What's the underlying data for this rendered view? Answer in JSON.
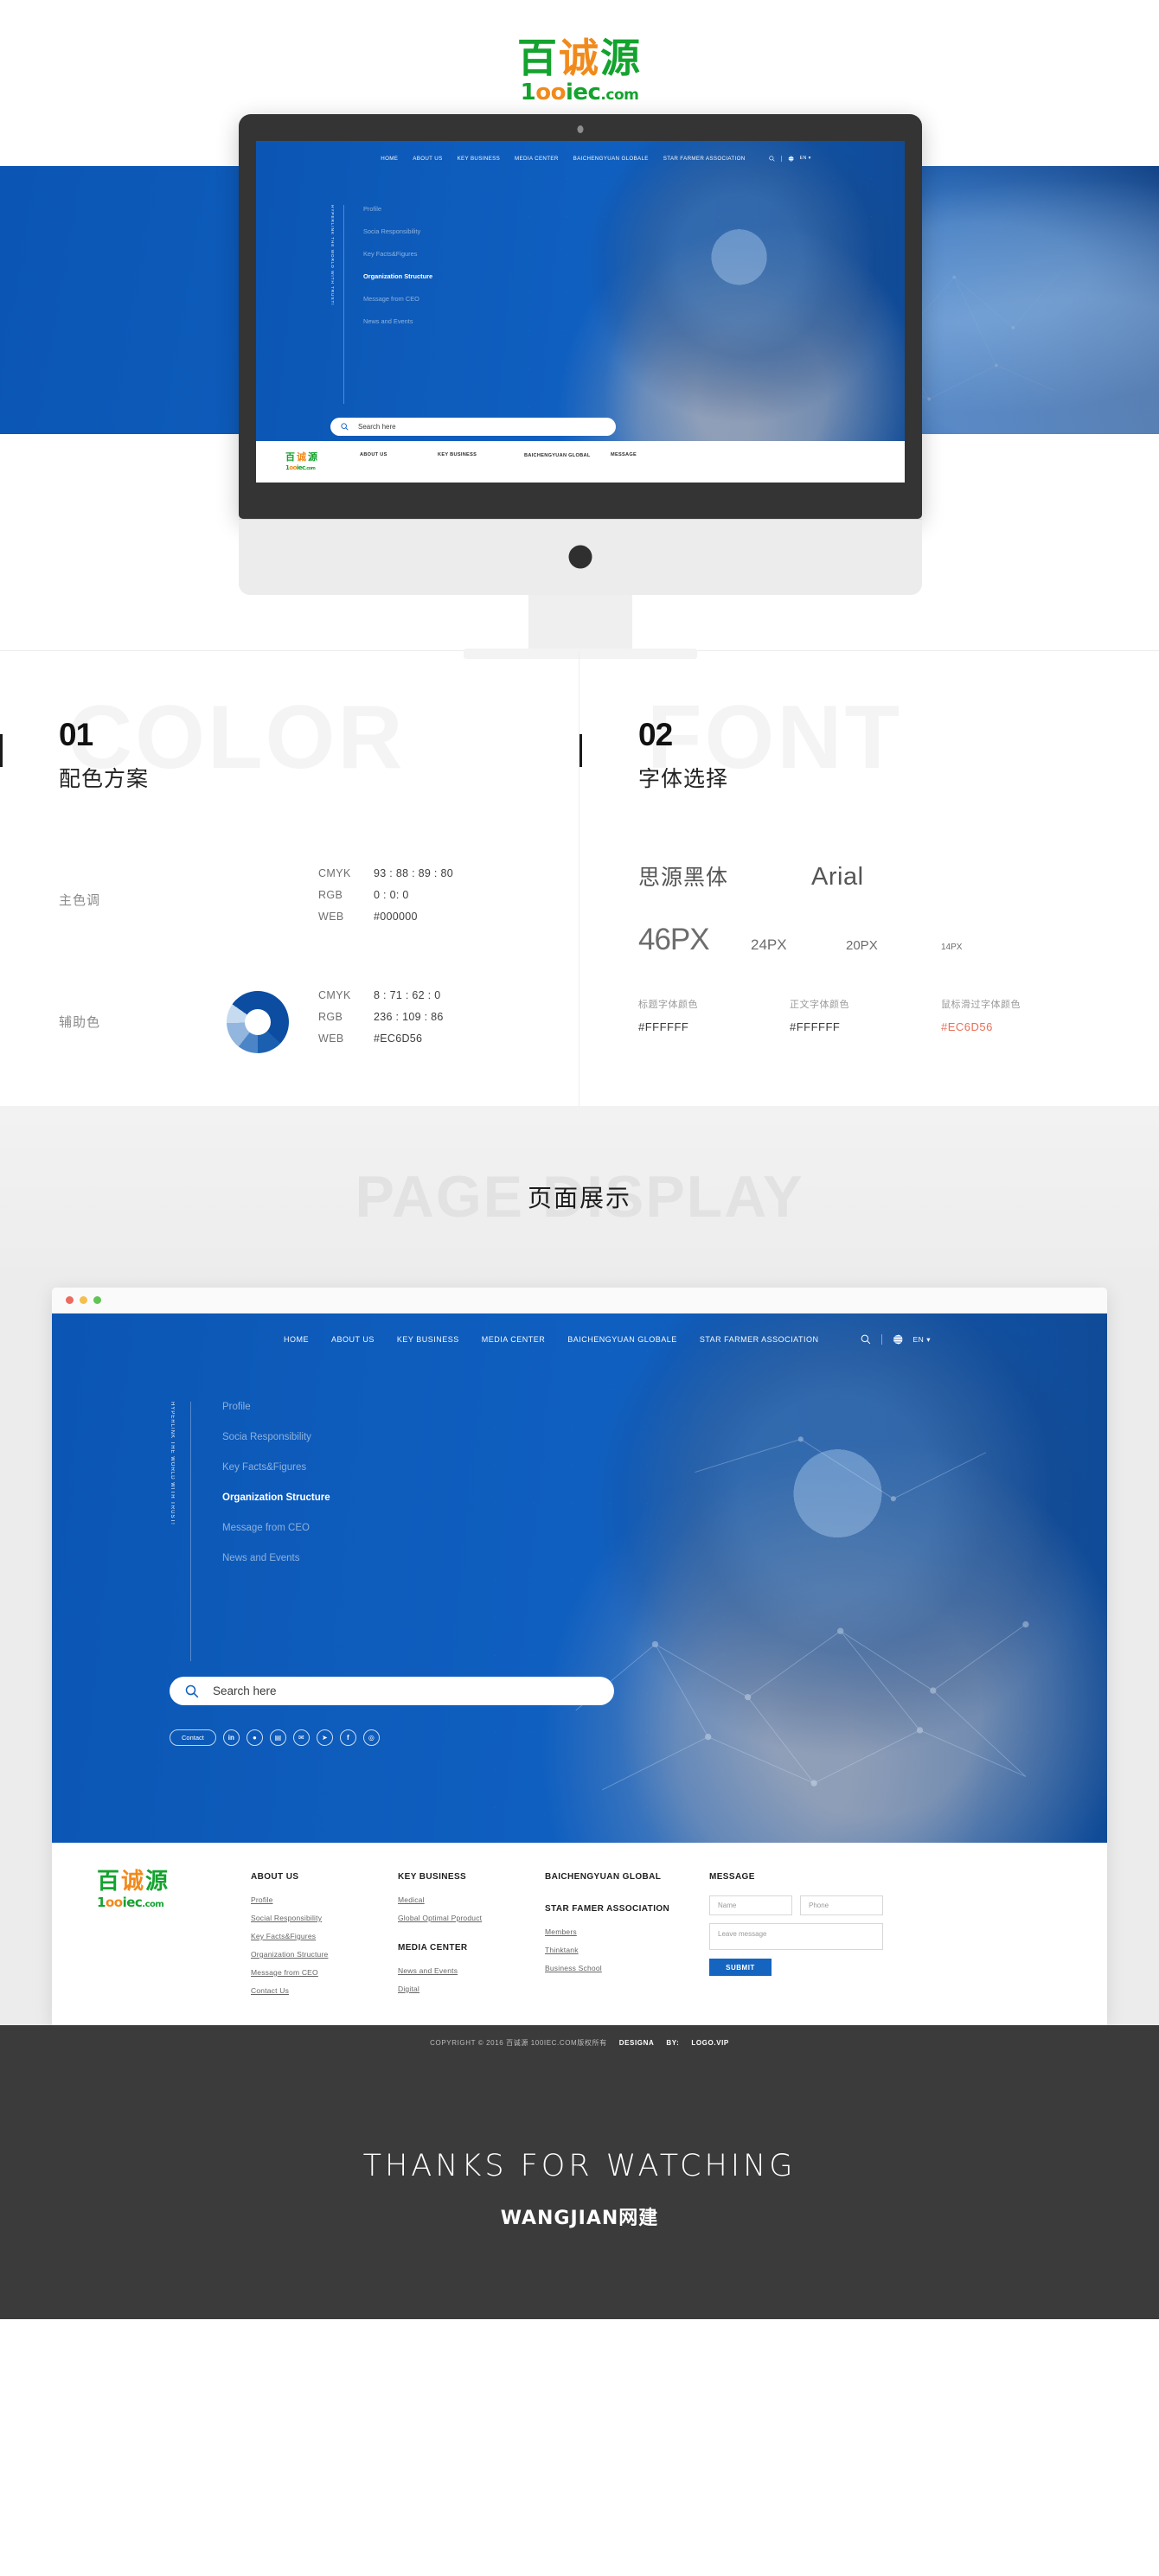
{
  "brand": {
    "logo_cn_1": "百",
    "logo_cn_2": "诚",
    "logo_cn_3": "源",
    "logo_en_pre": "1",
    "logo_en_o": "oo",
    "logo_en_post": "iec",
    "logo_en_com": ".com"
  },
  "site": {
    "nav": [
      {
        "label": "HOME"
      },
      {
        "label": "ABOUT US"
      },
      {
        "label": "KEY BUSINESS"
      },
      {
        "label": "MEDIA CENTER"
      },
      {
        "label": "BAICHENGYUAN GLOBALE"
      },
      {
        "label": "STAR FARMER ASSOCIATION"
      }
    ],
    "search_icon": "search-icon",
    "globe_icon": "globe-icon",
    "lang": "EN",
    "lang_caret": "▾",
    "vertical_tagline": "HYPERLINK THE WORLD WITH TRUST!",
    "sublinks": [
      {
        "label": "Profile",
        "active": false
      },
      {
        "label": "Socia Responsibility",
        "active": false
      },
      {
        "label": "Key Facts&Figures",
        "active": false
      },
      {
        "label": "Organization Structure",
        "active": true
      },
      {
        "label": "Message from CEO",
        "active": false
      },
      {
        "label": "News and Events",
        "active": false
      }
    ],
    "search_placeholder": "Search here",
    "contact_label": "Contact",
    "social": [
      {
        "name": "linkedin-icon",
        "glyph": "in"
      },
      {
        "name": "add-user-icon",
        "glyph": "👤"
      },
      {
        "name": "chat-icon",
        "glyph": "💬"
      },
      {
        "name": "mail-icon",
        "glyph": "✉"
      },
      {
        "name": "twitter-icon",
        "glyph": "🐦"
      },
      {
        "name": "facebook-icon",
        "glyph": "f"
      },
      {
        "name": "instagram-icon",
        "glyph": "◎"
      }
    ]
  },
  "mini_footer": {
    "links": [
      "ABOUT US",
      "KEY BUSINESS",
      "BAICHENGYUAN GLOBAL",
      "MESSAGE"
    ]
  },
  "spec_color": {
    "number": "01",
    "ghost": "COLOR",
    "title_cn": "配色方案",
    "rows": [
      {
        "label": "主色调",
        "swatch": "none",
        "values": [
          {
            "key": "CMYK",
            "value": "93 : 88 : 89 : 80"
          },
          {
            "key": "RGB",
            "value": "0 : 0: 0"
          },
          {
            "key": "WEB",
            "value": "#000000"
          }
        ]
      },
      {
        "label": "辅助色",
        "swatch": "donut",
        "values": [
          {
            "key": "CMYK",
            "value": "8 : 71 : 62 : 0"
          },
          {
            "key": "RGB",
            "value": "236 : 109 : 86"
          },
          {
            "key": "WEB",
            "value": "#EC6D56"
          }
        ]
      }
    ]
  },
  "spec_font": {
    "number": "02",
    "ghost": "FONT",
    "title_cn": "字体选择",
    "family_cn": "思源黑体",
    "family_en": "Arial",
    "sizes": [
      "46PX",
      "24PX",
      "20PX",
      "14PX"
    ],
    "colors": [
      {
        "caption": "标题字体颜色",
        "hex": "#FFFFFF",
        "accent": false
      },
      {
        "caption": "正文字体颜色",
        "hex": "#FFFFFF",
        "accent": false
      },
      {
        "caption": "鼠标滑过字体颜色",
        "hex": "#EC6D56",
        "accent": true
      }
    ]
  },
  "display": {
    "ghost": "PAGE DISPLAY",
    "title_cn": "页面展示"
  },
  "footer": {
    "columns": [
      {
        "heading": "ABOUT US",
        "heading2": "",
        "links": [
          "Profile",
          "Social Responsibility",
          "Key Facts&Figures",
          "Organization Structure",
          "Message from CEO",
          "Contact Us"
        ],
        "links2": []
      },
      {
        "heading": "KEY BUSINESS",
        "heading2": "MEDIA CENTER",
        "links": [
          "Medical",
          "Global Optimal Pproduct"
        ],
        "links2": [
          "News and Events",
          "Digital"
        ]
      },
      {
        "heading": "BAICHENGYUAN GLOBAL",
        "heading2": "STAR FAMER ASSOCIATION",
        "links": [],
        "links2": [
          "Members",
          "Thinktank",
          "Business School"
        ]
      }
    ],
    "message": {
      "heading": "MESSAGE",
      "name_placeholder": "Name",
      "phone_placeholder": "Phone",
      "message_placeholder": "Leave  message",
      "submit_label": "SUBMIT"
    },
    "copyright": "COPYRIGHT © 2016 百诚源 100IEC.COM版权所有",
    "designa": "DESIGNA",
    "by": "BY:",
    "by_value": "LOGO.VIP"
  },
  "thanks": {
    "title": "THANKS FOR WATCHING",
    "logo": "WANGJIAN网建"
  },
  "colors": {
    "brand_blue": "#0f5fc0",
    "accent": "#EC6D56",
    "logo_green": "#14a32e",
    "logo_orange": "#f18a1c",
    "dark": "#3b3b3b"
  }
}
